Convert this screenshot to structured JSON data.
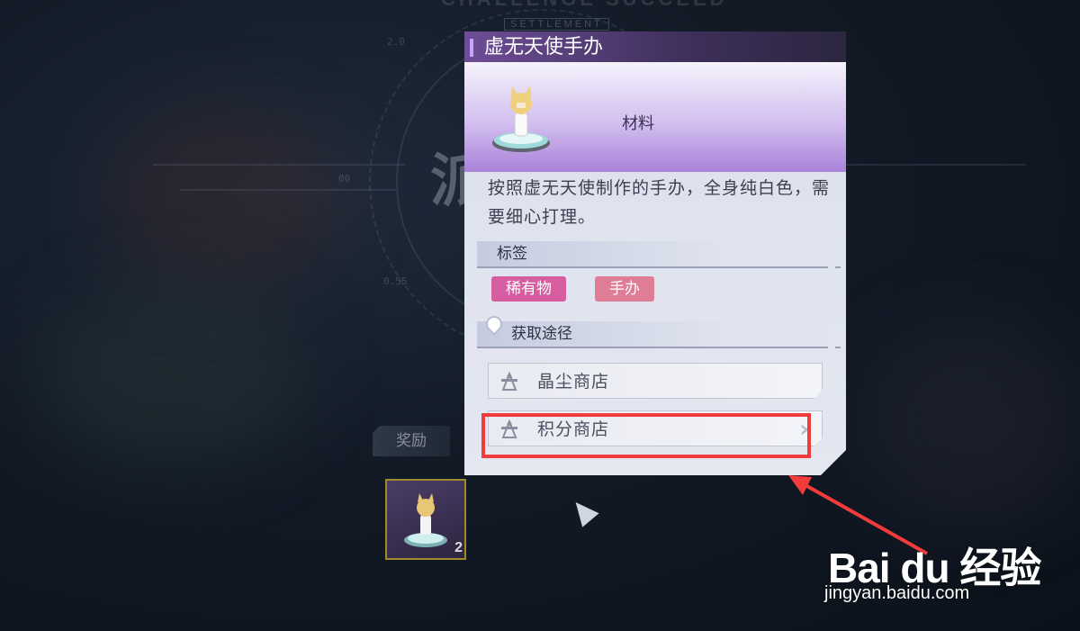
{
  "background": {
    "heading": "CHALLENGE SUCCEED",
    "subheading": "SETTLEMENT",
    "big_char": "派",
    "hud_text": [
      "2.0",
      "0.55",
      "00 "
    ]
  },
  "reward": {
    "tab_label": "奖励",
    "item_count": "2"
  },
  "panel": {
    "title": "虚无天使手办",
    "category": "材料",
    "description": "按照虚无天使制作的手办，全身纯白色，需要细心打理。",
    "tags_section_label": "标签",
    "tags": [
      "稀有物",
      "手办"
    ],
    "sources_section_label": "获取途径",
    "sources": [
      "晶尘商店",
      "积分商店"
    ],
    "colors": {
      "header": "#3d2f59",
      "tag_rare": "#d65ea0",
      "tag_figure": "#e07d96",
      "highlight": "#f23b3b"
    }
  },
  "watermark": {
    "logo": "Bai du 经验",
    "url": "jingyan.baidu.com"
  }
}
